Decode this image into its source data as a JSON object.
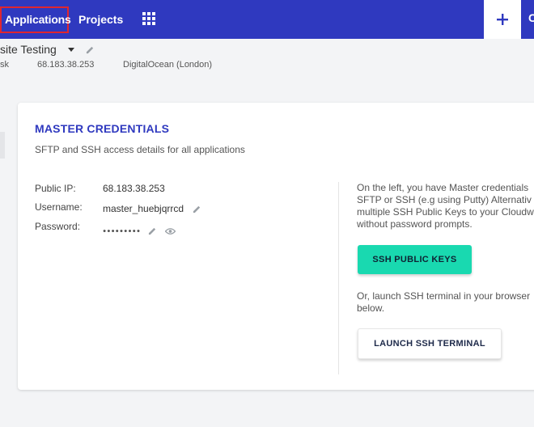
{
  "nav": {
    "applications": "Applications",
    "projects": "Projects",
    "right_edge": "C"
  },
  "server": {
    "title": "site Testing",
    "meta_left": "sk",
    "ip": "68.183.38.253",
    "provider": "DigitalOcean (London)"
  },
  "card": {
    "title": "MASTER CREDENTIALS",
    "subtitle": "SFTP and SSH access details for all applications",
    "public_ip_label": "Public IP:",
    "public_ip": "68.183.38.253",
    "username_label": "Username:",
    "username": "master_huebjqrrcd",
    "password_label": "Password:",
    "password_mask": "●●●●●●●●●",
    "info_lines": [
      "On the left, you have Master credentials",
      "SFTP or SSH (e.g using Putty) Alternativ",
      "multiple SSH Public Keys to your Cloudw",
      "without password prompts."
    ],
    "ssh_keys_button": "SSH PUBLIC KEYS",
    "terminal_lines": [
      "Or, launch SSH terminal in your browser",
      "below."
    ],
    "terminal_button": "LAUNCH SSH TERMINAL"
  },
  "colors": {
    "topbar": "#2f39bf",
    "accent_title": "#2f39bf",
    "ssh_button": "#19d9b0",
    "highlight_border": "#e0262f"
  }
}
